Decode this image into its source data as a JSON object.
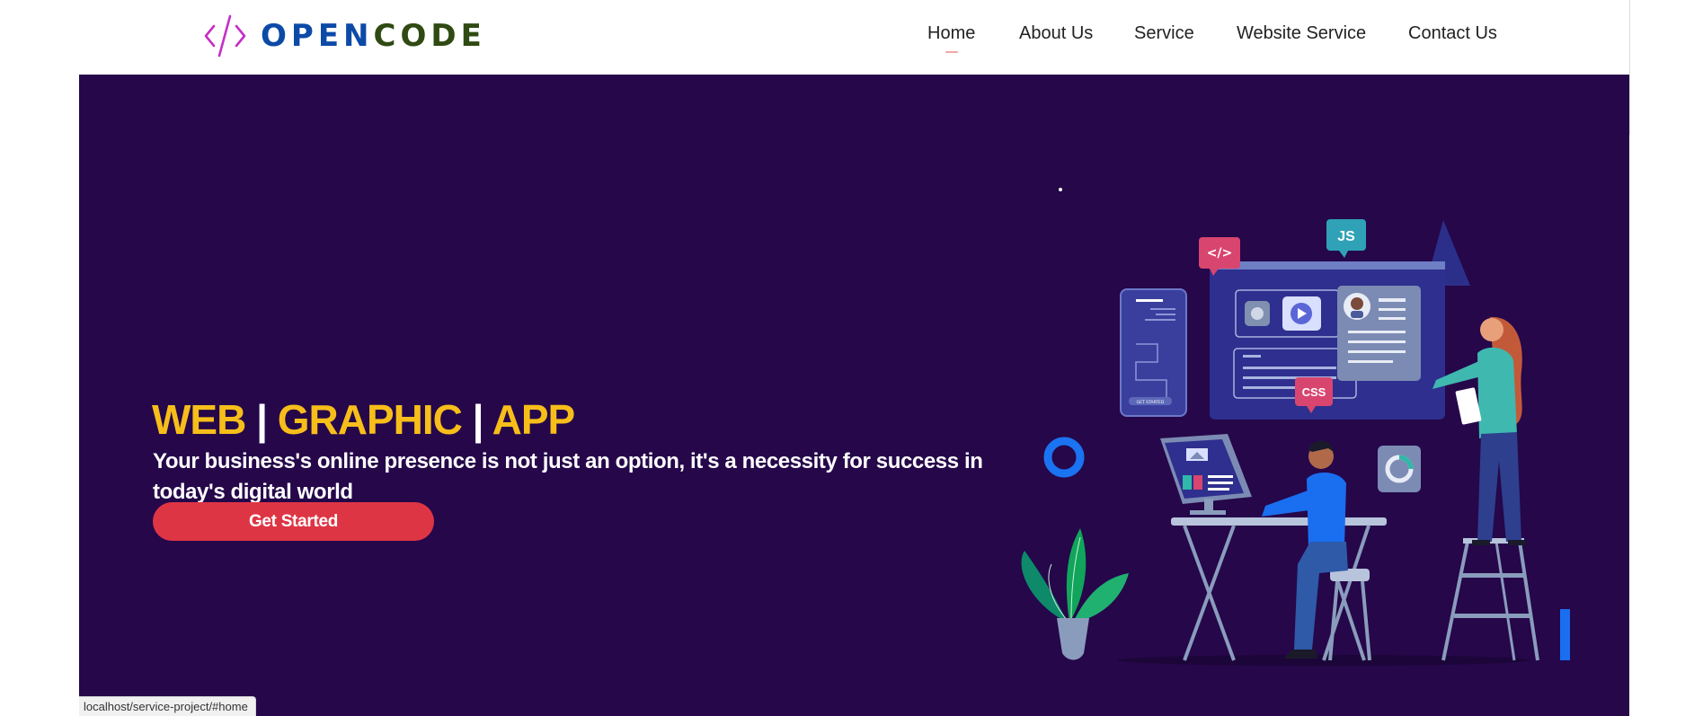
{
  "brand": {
    "part1": "OPEN",
    "part2": "CODE",
    "color_part1": "#0c4aa7",
    "color_part2": "#2f4a12",
    "icon": "code-brackets-icon"
  },
  "nav": {
    "items": [
      {
        "label": "Home",
        "active": true
      },
      {
        "label": "About Us",
        "active": false
      },
      {
        "label": "Service",
        "active": false
      },
      {
        "label": "Website Service",
        "active": false
      },
      {
        "label": "Contact Us",
        "active": false
      }
    ]
  },
  "hero": {
    "headline": {
      "part1": "WEB",
      "part2": "GRAPHIC",
      "part3": "APP",
      "separator": "|"
    },
    "subtitle": "Your business's online presence is not just an option, it's a necessity for success in today's digital world",
    "cta_label": "Get Started",
    "background": "#25074a",
    "headline_color": "#f7be1a",
    "cta_color": "#de3545",
    "illustration": {
      "badge_code": "</>",
      "badge_js": "JS",
      "badge_css": "CSS",
      "phone_button": "GET STARTED"
    }
  },
  "status_bar": {
    "url": "localhost/service-project/#home"
  }
}
